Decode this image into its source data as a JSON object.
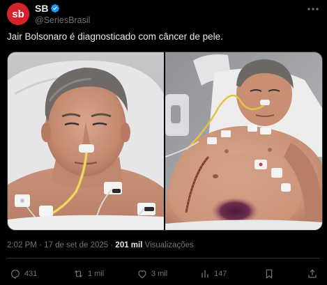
{
  "author": {
    "display_name": "SB",
    "handle": "@SeriesBrasil",
    "avatar_text": "sb",
    "verified": true
  },
  "tweet": {
    "text": "Jair Bolsonaro é diagnosticado com câncer de pele."
  },
  "media": {
    "count": 2
  },
  "meta": {
    "time": "2:02 PM",
    "date": "17 de set de 2025",
    "views_count": "201 mil",
    "views_label": "Visualizações",
    "separator": "·"
  },
  "actions": {
    "replies": "431",
    "reposts": "1 mil",
    "likes": "3 mil",
    "views": "147"
  },
  "colors": {
    "background": "#000000",
    "text": "#e7e9ea",
    "muted": "#71767b",
    "border": "#2f3336",
    "verified": "#1d9bf0",
    "avatar": "#d5232b"
  },
  "icons": [
    "verified-badge-icon",
    "more-icon",
    "reply-icon",
    "repost-icon",
    "like-icon",
    "views-icon",
    "bookmark-icon",
    "share-icon"
  ]
}
